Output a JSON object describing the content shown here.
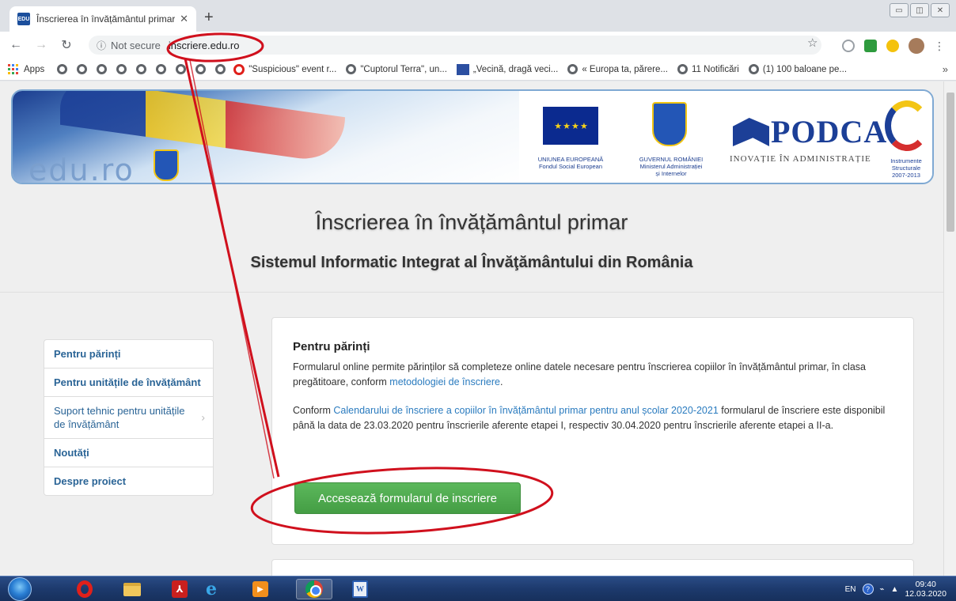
{
  "browser": {
    "tab_title": "Înscrierea în învățământul primar",
    "tab_favicon": "EDU",
    "new_tab": "+",
    "address": {
      "security_label": "Not secure",
      "url": "inscriere.edu.ro"
    },
    "bookmarks": {
      "apps_label": "Apps",
      "items": [
        "\"Suspicious\" event r...",
        "\"Cuptorul Terra\", un...",
        "„Vecină, dragă veci...",
        "« Europa ta, părere...",
        "11 Notificări",
        "(1) 100 baloane pe..."
      ],
      "more": "»"
    }
  },
  "banner": {
    "logo_text": "edu.ro",
    "eu_label": "UNIUNEA EUROPEANĂ\nFondul Social European",
    "gov_label": "GUVERNUL ROMÂNIEI\nMinisterul Administrației\nși Internelor",
    "podca_name": "PODCA",
    "podca_tagline": "INOVAȚIE ÎN ADMINISTRAȚIE",
    "instr_label": "Instrumente\nStructurale\n2007-2013"
  },
  "hero": {
    "title": "Înscrierea în învățământul primar",
    "subtitle": "Sistemul Informatic Integrat al Învăţământului din România"
  },
  "sidebar": {
    "items": [
      {
        "label": "Pentru părinți"
      },
      {
        "label": "Pentru unitățile de învățământ"
      },
      {
        "label": "Suport tehnic pentru unitățile de învățământ"
      },
      {
        "label": "Noutăți"
      },
      {
        "label": "Despre proiect"
      }
    ]
  },
  "panel": {
    "title": "Pentru părinți",
    "p1_text": "Formularul online permite părinților să completeze online datele necesare pentru înscrierea copiilor în învățământul primar, în clasa pregătitoare, conform ",
    "p1_link": "metodologiei de înscriere",
    "p1_end": ".",
    "p2_prefix": "Conform ",
    "p2_link": "Calendarului de înscriere a copiilor în învățământul primar pentru anul școlar 2020-2021",
    "p2_rest": " formularul de înscriere este disponibil până la data de 23.03.2020 pentru înscrierile aferente etapei I, respectiv 30.04.2020 pentru înscrierile aferente etapei a II-a.",
    "cta_label": "Accesează formularul de inscriere"
  },
  "taskbar": {
    "lang": "EN",
    "time": "09:40",
    "date": "12.03.2020"
  },
  "colors": {
    "accent_green": "#5cb85c",
    "link_blue": "#2a7bbf",
    "annotation_red": "#d0101d"
  }
}
